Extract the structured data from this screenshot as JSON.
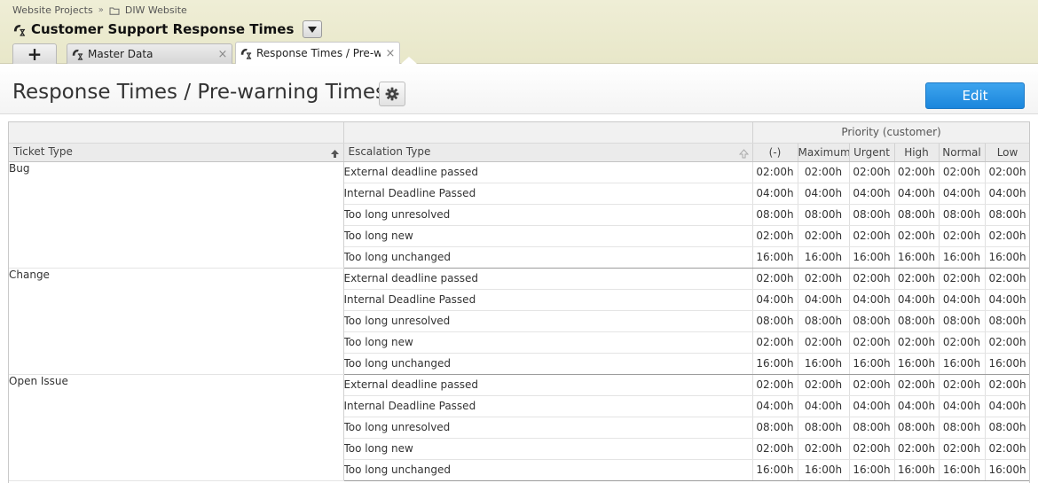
{
  "breadcrumb": {
    "root": "Website Projects",
    "sep": "»",
    "current": "DIW Website"
  },
  "project": {
    "title": "Customer Support Response Times"
  },
  "tabs": {
    "add_label": "+",
    "items": [
      {
        "label": "Master Data",
        "close": "×"
      },
      {
        "label": "Response Times / Pre-warning Times",
        "close": "×",
        "active": true
      }
    ]
  },
  "page": {
    "title": "Response Times / Pre-warning Times",
    "edit_label": "Edit"
  },
  "table": {
    "group_header": "Priority (customer)",
    "columns": {
      "ticket_type": "Ticket Type",
      "escalation_type": "Escalation Type",
      "priorities": [
        "(-)",
        "Maximum",
        "Urgent",
        "High",
        "Normal",
        "Low"
      ]
    },
    "groups": [
      {
        "ticket_type": "Bug",
        "rows": [
          {
            "escalation": "External deadline passed",
            "values": [
              "02:00h",
              "02:00h",
              "02:00h",
              "02:00h",
              "02:00h",
              "02:00h"
            ]
          },
          {
            "escalation": "Internal Deadline Passed",
            "values": [
              "04:00h",
              "04:00h",
              "04:00h",
              "04:00h",
              "04:00h",
              "04:00h"
            ]
          },
          {
            "escalation": "Too long unresolved",
            "values": [
              "08:00h",
              "08:00h",
              "08:00h",
              "08:00h",
              "08:00h",
              "08:00h"
            ]
          },
          {
            "escalation": "Too long new",
            "values": [
              "02:00h",
              "02:00h",
              "02:00h",
              "02:00h",
              "02:00h",
              "02:00h"
            ]
          },
          {
            "escalation": "Too long unchanged",
            "values": [
              "16:00h",
              "16:00h",
              "16:00h",
              "16:00h",
              "16:00h",
              "16:00h"
            ]
          }
        ]
      },
      {
        "ticket_type": "Change",
        "rows": [
          {
            "escalation": "External deadline passed",
            "values": [
              "02:00h",
              "02:00h",
              "02:00h",
              "02:00h",
              "02:00h",
              "02:00h"
            ]
          },
          {
            "escalation": "Internal Deadline Passed",
            "values": [
              "04:00h",
              "04:00h",
              "04:00h",
              "04:00h",
              "04:00h",
              "04:00h"
            ]
          },
          {
            "escalation": "Too long unresolved",
            "values": [
              "08:00h",
              "08:00h",
              "08:00h",
              "08:00h",
              "08:00h",
              "08:00h"
            ]
          },
          {
            "escalation": "Too long new",
            "values": [
              "02:00h",
              "02:00h",
              "02:00h",
              "02:00h",
              "02:00h",
              "02:00h"
            ]
          },
          {
            "escalation": "Too long unchanged",
            "values": [
              "16:00h",
              "16:00h",
              "16:00h",
              "16:00h",
              "16:00h",
              "16:00h"
            ]
          }
        ]
      },
      {
        "ticket_type": "Open Issue",
        "rows": [
          {
            "escalation": "External deadline passed",
            "values": [
              "02:00h",
              "02:00h",
              "02:00h",
              "02:00h",
              "02:00h",
              "02:00h"
            ]
          },
          {
            "escalation": "Internal Deadline Passed",
            "values": [
              "04:00h",
              "04:00h",
              "04:00h",
              "04:00h",
              "04:00h",
              "04:00h"
            ]
          },
          {
            "escalation": "Too long unresolved",
            "values": [
              "08:00h",
              "08:00h",
              "08:00h",
              "08:00h",
              "08:00h",
              "08:00h"
            ]
          },
          {
            "escalation": "Too long new",
            "values": [
              "02:00h",
              "02:00h",
              "02:00h",
              "02:00h",
              "02:00h",
              "02:00h"
            ]
          },
          {
            "escalation": "Too long unchanged",
            "values": [
              "16:00h",
              "16:00h",
              "16:00h",
              "16:00h",
              "16:00h",
              "16:00h"
            ]
          }
        ]
      }
    ]
  },
  "icons": {
    "app": "support-clock-icon",
    "folder": "folder-icon",
    "gear": "gear-icon",
    "dropdown": "caret-down-icon",
    "sort": "sort-arrow-icon"
  },
  "colors": {
    "header_bg": "#ecebcf",
    "edit_button": "#2a94e5",
    "group_border": "#9c9c9c"
  }
}
